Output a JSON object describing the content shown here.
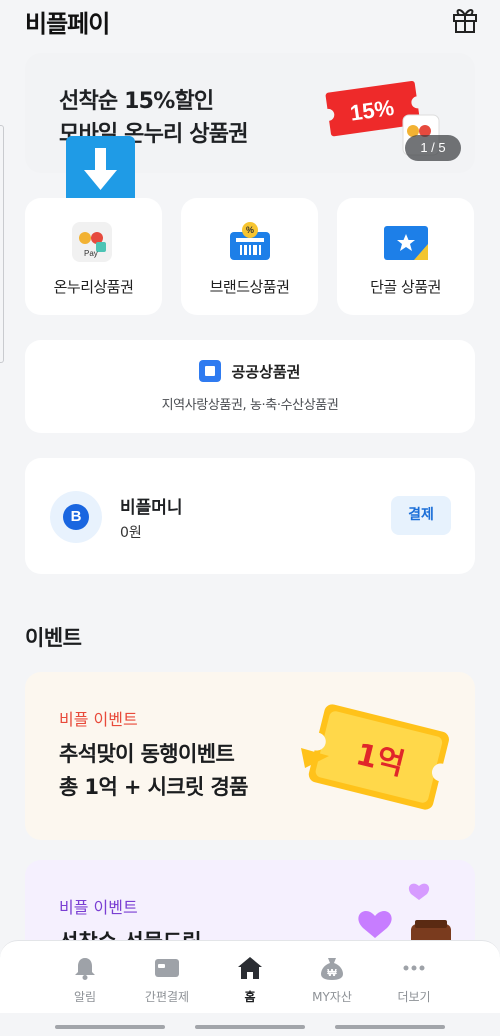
{
  "header": {
    "title": "비플페이"
  },
  "banner": {
    "line1": "선착순 15%할인",
    "line2": "모바일 온누리 상품권",
    "badge": "15%",
    "counter": "1 / 5"
  },
  "tiles": [
    {
      "label": "온누리상품권",
      "icon": "onnuri-pay-icon"
    },
    {
      "label": "브랜드상품권",
      "icon": "brand-voucher-icon"
    },
    {
      "label": "단골 상품권",
      "icon": "regular-store-voucher-icon"
    }
  ],
  "public_voucher": {
    "title": "공공상품권",
    "subtitle": "지역사랑상품권, 농·축·수산상품권"
  },
  "money": {
    "avatar_letter": "B",
    "name": "비플머니",
    "balance": "0원",
    "pay_label": "결제"
  },
  "events_section": {
    "title": "이벤트",
    "event1": {
      "tag": "비플 이벤트",
      "line1": "추석맞이 동행이벤트",
      "line2": "총 1억 + 시크릿 경품",
      "badge": "1억"
    },
    "event2": {
      "tag": "비플 이벤트",
      "line1": "선착순 선물드림"
    }
  },
  "tabbar": {
    "items": [
      {
        "label": "알림",
        "icon": "bell-icon"
      },
      {
        "label": "간편결제",
        "icon": "card-icon"
      },
      {
        "label": "홈",
        "icon": "home-icon",
        "active": true
      },
      {
        "label": "MY자산",
        "icon": "money-bag-icon"
      },
      {
        "label": "더보기",
        "icon": "more-dots-icon"
      }
    ]
  },
  "colors": {
    "accent": "#1a66e0",
    "event_red": "#e84a3a",
    "event_purple": "#7a3ed3"
  }
}
